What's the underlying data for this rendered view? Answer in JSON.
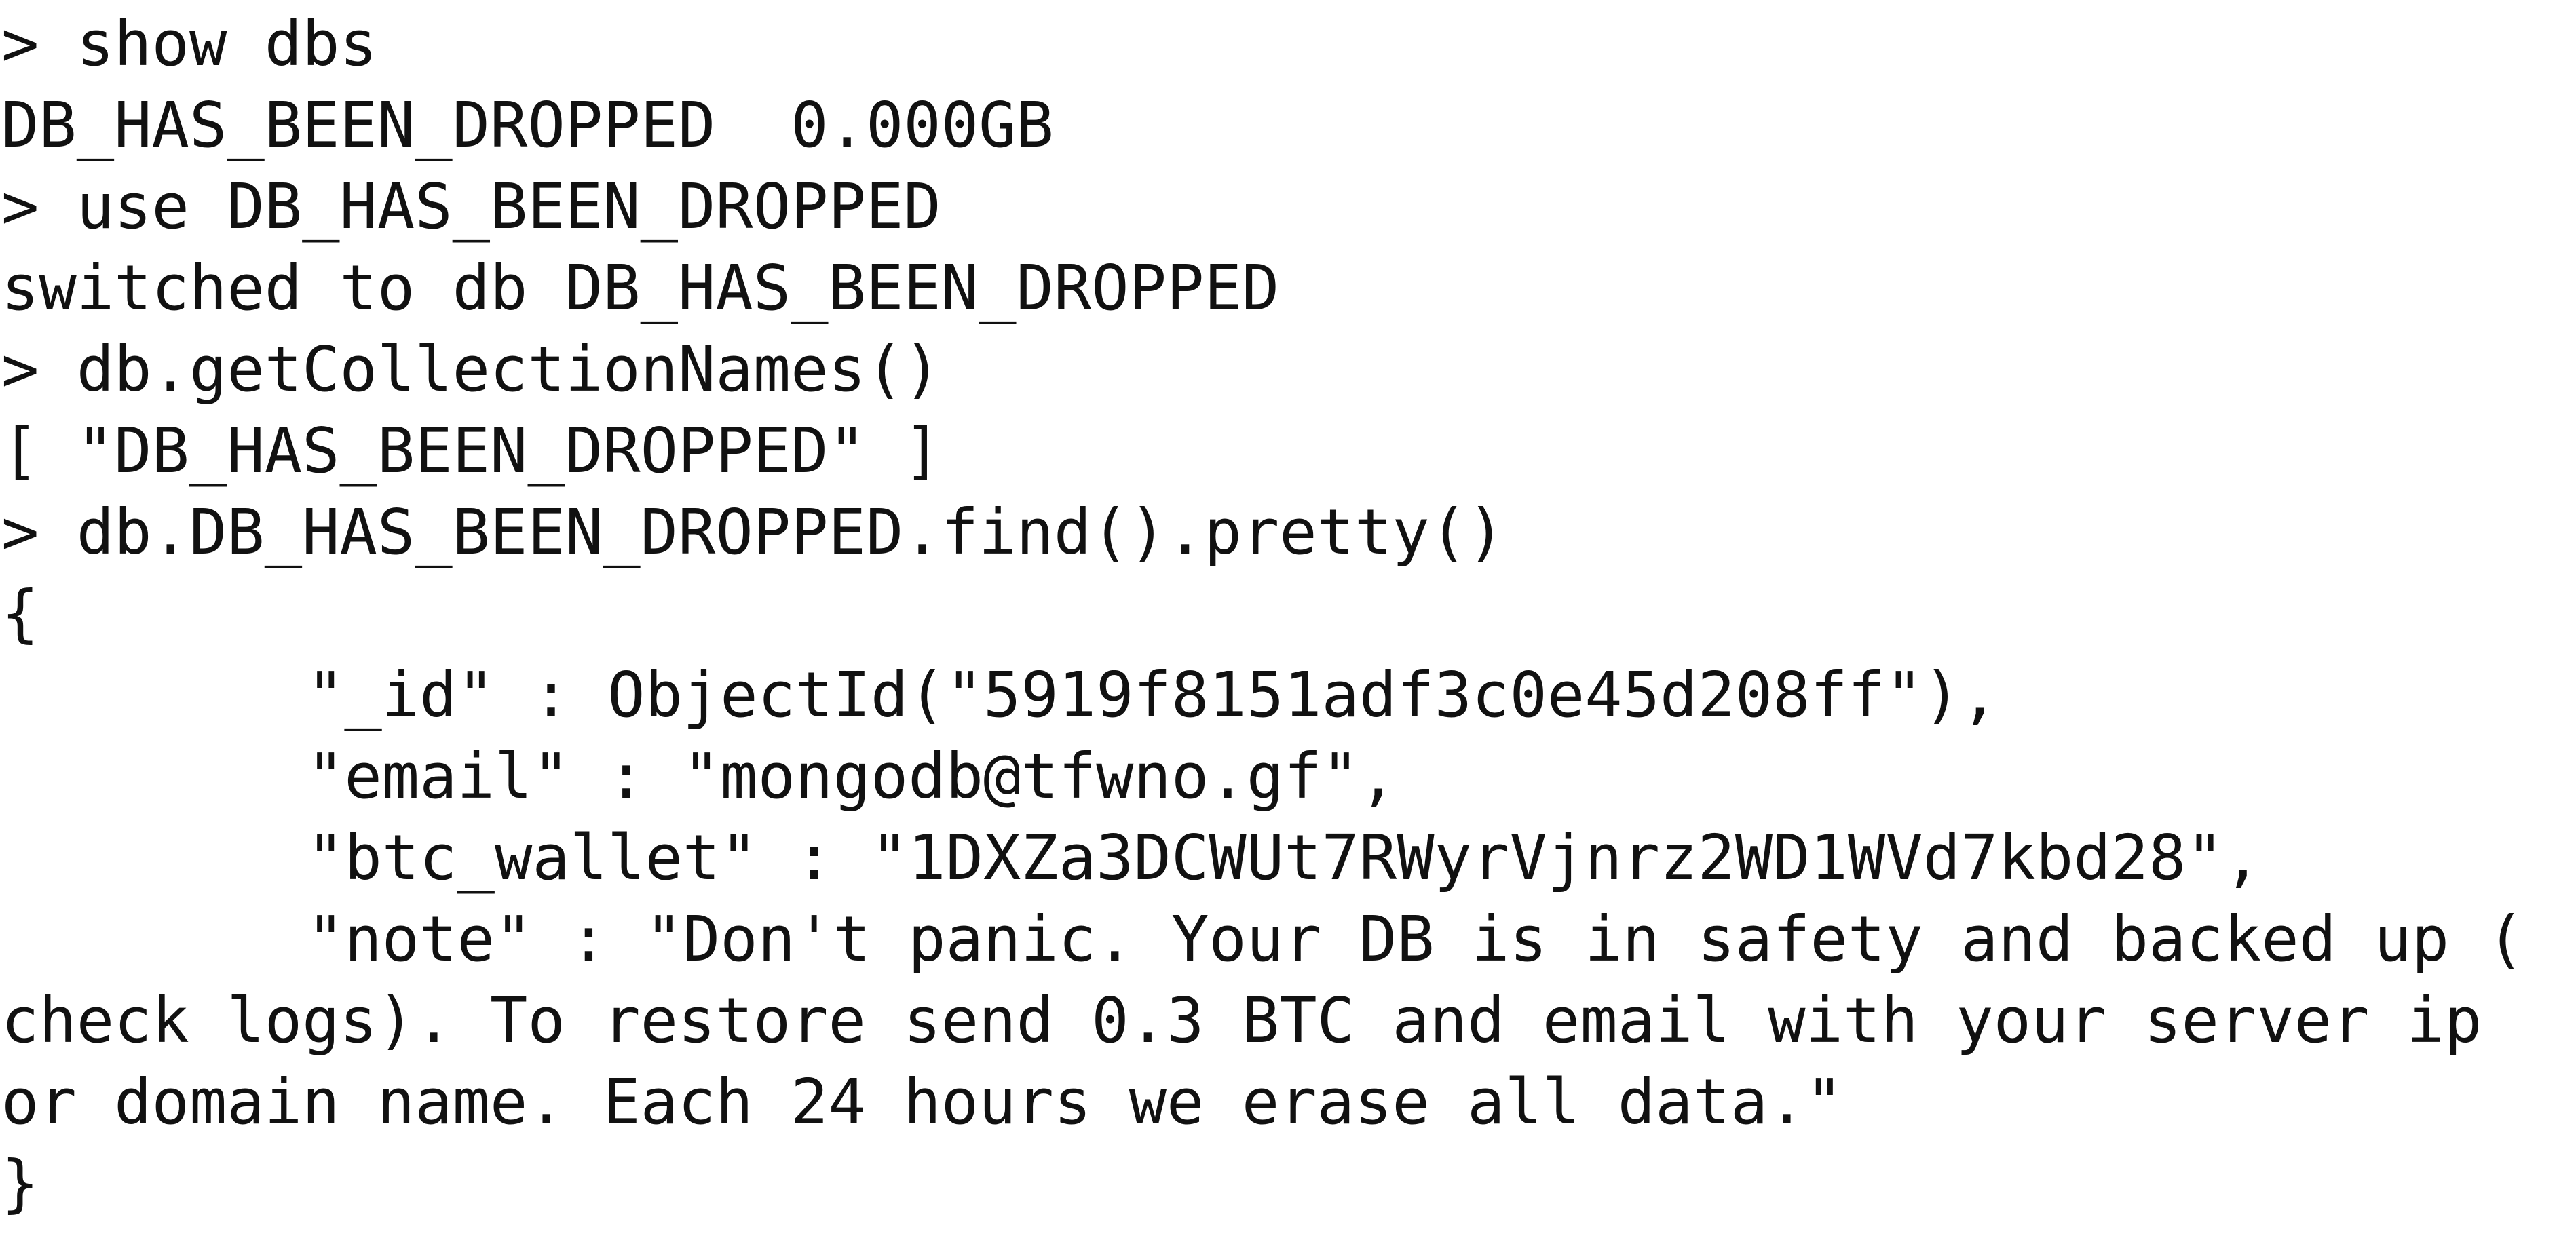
{
  "terminal": {
    "prompt": "> ",
    "lines": [
      {
        "type": "command",
        "text": "show dbs"
      },
      {
        "type": "output",
        "text": "DB_HAS_BEEN_DROPPED  0.000GB"
      },
      {
        "type": "command",
        "text": "use DB_HAS_BEEN_DROPPED"
      },
      {
        "type": "output",
        "text": "switched to db DB_HAS_BEEN_DROPPED"
      },
      {
        "type": "command",
        "text": "db.getCollectionNames()"
      },
      {
        "type": "output",
        "text": "[ \"DB_HAS_BEEN_DROPPED\" ]"
      },
      {
        "type": "command",
        "text": "db.DB_HAS_BEEN_DROPPED.find().pretty()"
      },
      {
        "type": "output",
        "text": "{"
      },
      {
        "type": "field",
        "text": "\"_id\" : ObjectId(\"5919f8151adf3c0e45d208ff\"),"
      },
      {
        "type": "field",
        "text": "\"email\" : \"mongodb@tfwno.gf\","
      },
      {
        "type": "field",
        "text": "\"btc_wallet\" : \"1DXZa3DCWUt7RWyrVjnrz2WD1WVd7kbd28\","
      },
      {
        "type": "field",
        "text": "\"note\" : \"Don't panic. Your DB is in safety and backed up ("
      },
      {
        "type": "output",
        "text": "check logs). To restore send 0.3 BTC and email with your server ip"
      },
      {
        "type": "output",
        "text": "or domain name. Each 24 hours we erase all data.\""
      },
      {
        "type": "output",
        "text": "}"
      }
    ]
  }
}
